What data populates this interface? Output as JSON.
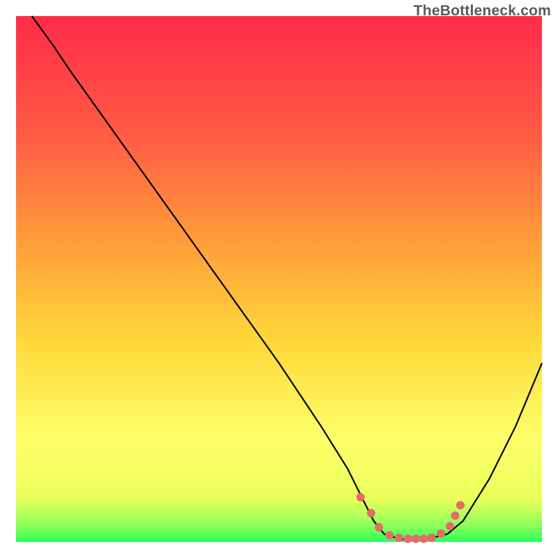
{
  "watermark": "TheBottleneck.com",
  "chart_data": {
    "type": "line",
    "title": "",
    "xlabel": "",
    "ylabel": "",
    "xlim": [
      0,
      100
    ],
    "ylim": [
      0,
      100
    ],
    "background_gradient": {
      "top": "#ff2b4a",
      "upper_mid": "#ff8a3a",
      "mid": "#ffd93a",
      "lower_mid": "#ffff70",
      "bottom": "#2bff5a"
    },
    "series": [
      {
        "name": "bottleneck-curve",
        "color": "#000000",
        "points": [
          {
            "x": 3.0,
            "y": 100.0
          },
          {
            "x": 7.0,
            "y": 94.5
          },
          {
            "x": 10.0,
            "y": 90.0
          },
          {
            "x": 20.0,
            "y": 76.0
          },
          {
            "x": 30.0,
            "y": 62.0
          },
          {
            "x": 40.0,
            "y": 48.0
          },
          {
            "x": 50.0,
            "y": 34.0
          },
          {
            "x": 58.0,
            "y": 22.0
          },
          {
            "x": 63.0,
            "y": 14.0
          },
          {
            "x": 66.0,
            "y": 8.0
          },
          {
            "x": 68.0,
            "y": 4.0
          },
          {
            "x": 70.0,
            "y": 1.5
          },
          {
            "x": 73.0,
            "y": 0.5
          },
          {
            "x": 78.0,
            "y": 0.5
          },
          {
            "x": 82.0,
            "y": 1.5
          },
          {
            "x": 85.0,
            "y": 4.0
          },
          {
            "x": 90.0,
            "y": 12.0
          },
          {
            "x": 95.0,
            "y": 22.0
          },
          {
            "x": 100.0,
            "y": 34.0
          }
        ]
      },
      {
        "name": "high-bottleneck-dots",
        "color": "#e86a6a",
        "style": "dots",
        "points": [
          {
            "x": 65.5,
            "y": 8.5
          },
          {
            "x": 67.5,
            "y": 5.5
          },
          {
            "x": 69.0,
            "y": 2.8
          },
          {
            "x": 71.0,
            "y": 1.3
          },
          {
            "x": 72.8,
            "y": 0.8
          },
          {
            "x": 74.5,
            "y": 0.6
          },
          {
            "x": 76.0,
            "y": 0.6
          },
          {
            "x": 77.5,
            "y": 0.6
          },
          {
            "x": 79.0,
            "y": 0.8
          },
          {
            "x": 80.8,
            "y": 1.6
          },
          {
            "x": 82.5,
            "y": 3.0
          },
          {
            "x": 83.5,
            "y": 5.0
          },
          {
            "x": 84.5,
            "y": 7.0
          }
        ]
      }
    ]
  }
}
